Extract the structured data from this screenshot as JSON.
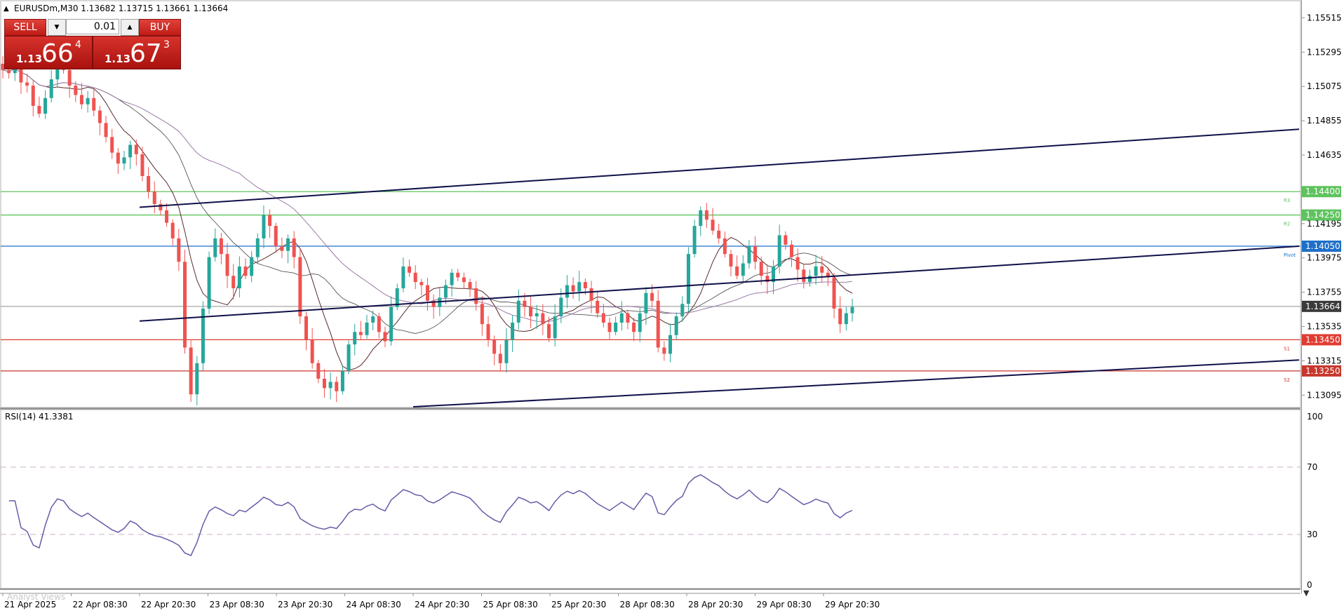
{
  "header": {
    "symbol_line": "EURUSDm,M30  1.13682 1.13715 1.13661 1.13664"
  },
  "trade_panel": {
    "sell_label": "SELL",
    "buy_label": "BUY",
    "volume": "0.01",
    "sell_price": {
      "prefix": "1.13",
      "big": "66",
      "sup": "4"
    },
    "buy_price": {
      "prefix": "1.13",
      "big": "67",
      "sup": "3"
    }
  },
  "price_axis": {
    "ticks": [
      "1.15515",
      "1.15295",
      "1.15075",
      "1.14855",
      "1.14635",
      "1.14195",
      "1.13975",
      "1.13755",
      "1.13535",
      "1.13315",
      "1.13095"
    ]
  },
  "levels": [
    {
      "price": 1.144,
      "label": "1.14400",
      "name": "R3",
      "color": "#5ec35e"
    },
    {
      "price": 1.1425,
      "label": "1.14250",
      "name": "R2",
      "color": "#5ec35e"
    },
    {
      "price": 1.1405,
      "label": "1.14050",
      "name": "Pivot",
      "color": "#1e6fc9"
    },
    {
      "price": 1.1345,
      "label": "1.13450",
      "name": "S1",
      "color": "#e03c32"
    },
    {
      "price": 1.1325,
      "label": "1.13250",
      "name": "S2",
      "color": "#c8372d"
    }
  ],
  "current_price": {
    "price": 1.13664,
    "label": "1.13664",
    "color": "#3a3a3a"
  },
  "rsi": {
    "label": "RSI(14) 41.3381",
    "levels": [
      {
        "value": 100,
        "label": "100"
      },
      {
        "value": 70,
        "label": "70"
      },
      {
        "value": 30,
        "label": "30"
      },
      {
        "value": 0,
        "label": "0"
      }
    ]
  },
  "time_axis": {
    "labels": [
      "21 Apr 2025",
      "22 Apr 08:30",
      "22 Apr 20:30",
      "23 Apr 08:30",
      "23 Apr 20:30",
      "24 Apr 08:30",
      "24 Apr 20:30",
      "25 Apr 08:30",
      "25 Apr 20:30",
      "28 Apr 08:30",
      "28 Apr 20:30",
      "29 Apr 08:30",
      "29 Apr 20:30"
    ]
  },
  "footer": {
    "tab_label": "Analyst Views"
  },
  "colors": {
    "bull": "#26a69a",
    "bear": "#ef5350",
    "trendline": "#10104a"
  },
  "chart_data": {
    "type": "candlestick",
    "price_range": [
      1.1302,
      1.1562
    ],
    "rsi_range": [
      0,
      100
    ],
    "trendlines": [
      {
        "from": [
          "22 Apr 20:30",
          1.143
        ],
        "to": [
          "end",
          1.148
        ]
      },
      {
        "from": [
          "22 Apr 20:30",
          1.1357
        ],
        "to": [
          "end",
          1.1405
        ]
      },
      {
        "from": [
          "24 Apr 20:30",
          1.1302
        ],
        "to": [
          "end",
          1.1332
        ]
      }
    ],
    "candle_closes": [
      1.1518,
      1.1516,
      1.1522,
      1.151,
      1.1508,
      1.1495,
      1.149,
      1.15,
      1.1512,
      1.152,
      1.1518,
      1.1508,
      1.1502,
      1.1496,
      1.15,
      1.1492,
      1.1484,
      1.1475,
      1.1465,
      1.1458,
      1.1462,
      1.147,
      1.1464,
      1.145,
      1.144,
      1.1432,
      1.1428,
      1.142,
      1.141,
      1.1395,
      1.134,
      1.131,
      1.133,
      1.1365,
      1.1398,
      1.141,
      1.14,
      1.1386,
      1.1378,
      1.1392,
      1.1386,
      1.1398,
      1.141,
      1.1425,
      1.1418,
      1.1405,
      1.1402,
      1.141,
      1.1398,
      1.136,
      1.1345,
      1.133,
      1.132,
      1.1314,
      1.1318,
      1.1312,
      1.1325,
      1.1342,
      1.135,
      1.1348,
      1.1356,
      1.136,
      1.135,
      1.1344,
      1.1366,
      1.1378,
      1.1392,
      1.1388,
      1.1382,
      1.138,
      1.137,
      1.1366,
      1.1372,
      1.138,
      1.1388,
      1.1385,
      1.1382,
      1.1378,
      1.1368,
      1.1355,
      1.1345,
      1.1336,
      1.133,
      1.1345,
      1.1356,
      1.137,
      1.1366,
      1.136,
      1.1362,
      1.1355,
      1.1346,
      1.136,
      1.1372,
      1.138,
      1.1376,
      1.1382,
      1.1378,
      1.137,
      1.1362,
      1.1356,
      1.135,
      1.1356,
      1.1362,
      1.1356,
      1.135,
      1.1362,
      1.1375,
      1.137,
      1.134,
      1.1336,
      1.1348,
      1.136,
      1.1368,
      1.14,
      1.1418,
      1.1428,
      1.1422,
      1.1415,
      1.141,
      1.14,
      1.1392,
      1.1386,
      1.1394,
      1.1405,
      1.1395,
      1.1386,
      1.1382,
      1.1392,
      1.1412,
      1.1406,
      1.1398,
      1.139,
      1.1382,
      1.1386,
      1.1392,
      1.1388,
      1.1385,
      1.1365,
      1.1355,
      1.1362,
      1.1366
    ]
  }
}
